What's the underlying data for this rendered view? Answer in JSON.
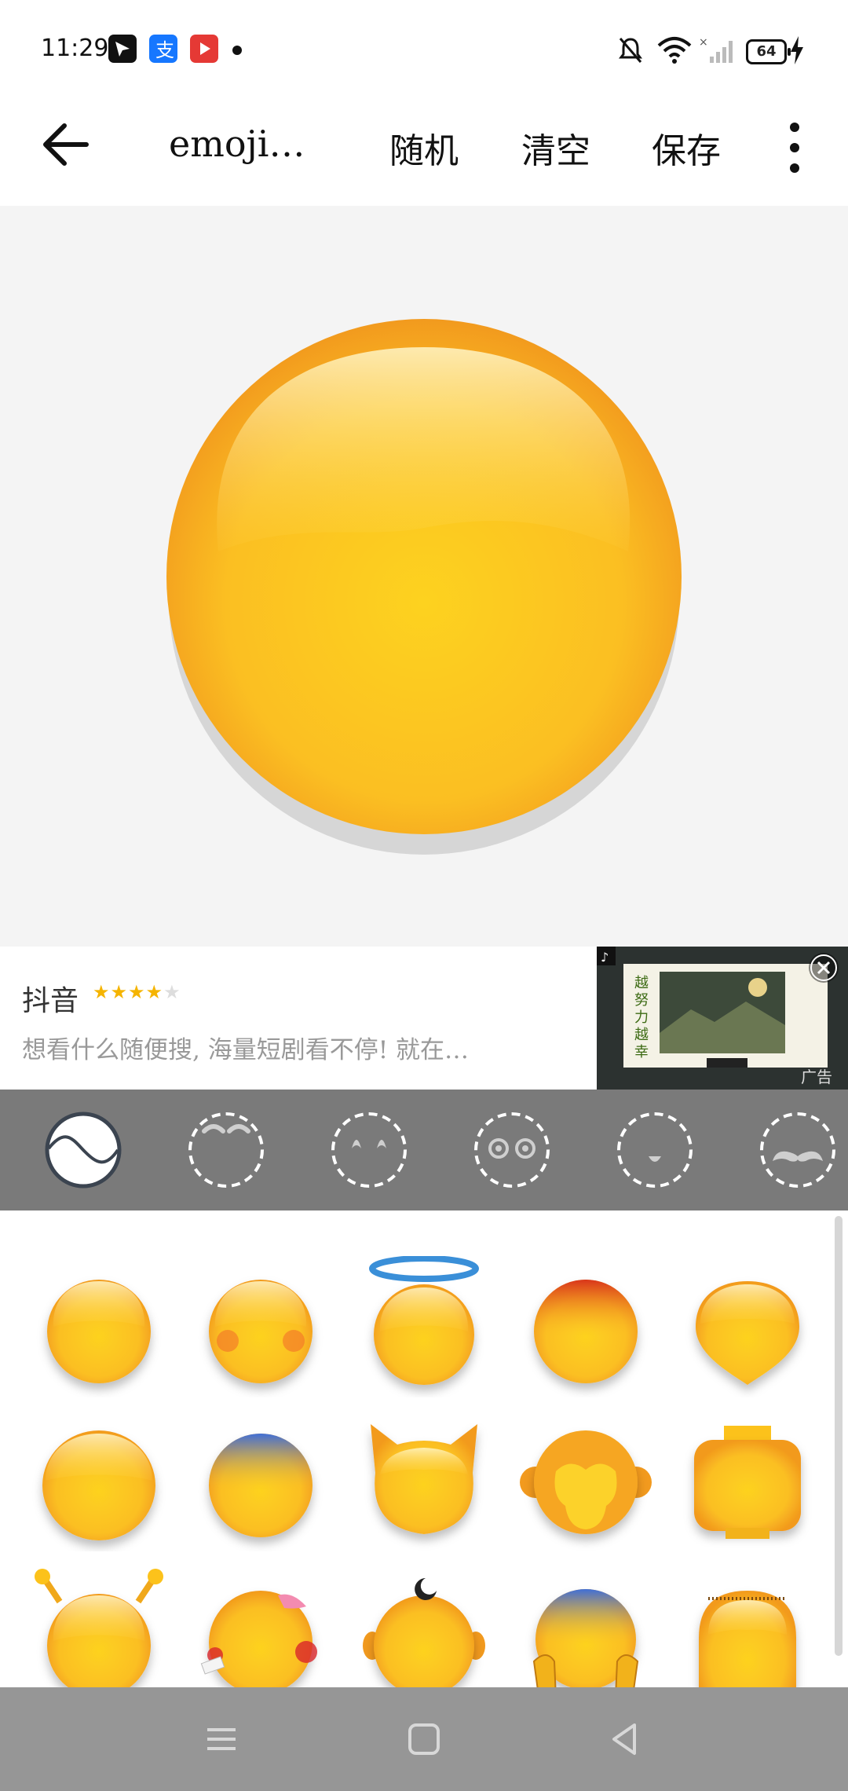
{
  "status_bar": {
    "time": "11:29",
    "battery": "64",
    "apps": [
      "feishu-app-icon",
      "alipay-app-icon",
      "video-app-icon"
    ]
  },
  "toolbar": {
    "title": "emoji…",
    "random_label": "随机",
    "clear_label": "清空",
    "save_label": "保存"
  },
  "ad": {
    "app_name": "抖音",
    "rating_stars": "★★★★★",
    "rating": 4.5,
    "text": "想看什么随便搜, 海量短剧看不停! 就在…",
    "tag": "广告"
  },
  "category_tabs": [
    {
      "name": "face-shape",
      "selected": true
    },
    {
      "name": "eyebrows",
      "selected": false
    },
    {
      "name": "eyes",
      "selected": false
    },
    {
      "name": "eyes-round",
      "selected": false
    },
    {
      "name": "mouth",
      "selected": false
    },
    {
      "name": "mustache",
      "selected": false
    }
  ],
  "face_options": [
    "round",
    "blush",
    "halo",
    "red-top",
    "pointed-bottom",
    "wide",
    "blue-top",
    "cat",
    "monkey",
    "lego",
    "antennae",
    "bandaged",
    "crescent",
    "blue-hands",
    "tall-hairy"
  ],
  "colors": {
    "face_main": "#fcc21b",
    "face_dark": "#f29a1e",
    "tab_bg": "#7a7a7a",
    "preview_bg": "#f4f4f4",
    "navbar_bg": "#969696"
  }
}
